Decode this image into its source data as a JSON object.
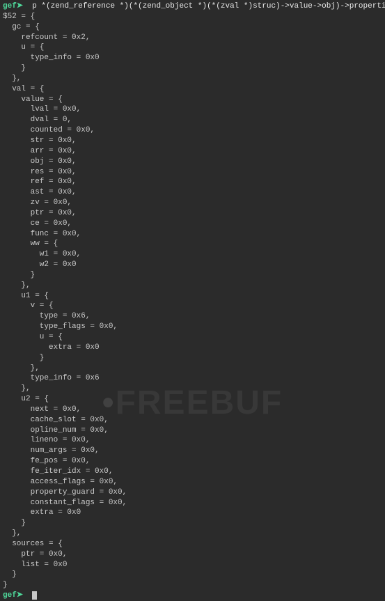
{
  "prompt_label": "gef➤",
  "command": "  p *(zend_reference *)(*(zend_object *)(*(zval *)struc)->value->obj)->properties_table->value->ref",
  "lines": [
    "$52 = {",
    "  gc = {",
    "    refcount = 0x2,",
    "    u = {",
    "      type_info = 0x0",
    "    }",
    "  },",
    "  val = {",
    "    value = {",
    "      lval = 0x0,",
    "      dval = 0,",
    "      counted = 0x0,",
    "      str = 0x0,",
    "      arr = 0x0,",
    "      obj = 0x0,",
    "      res = 0x0,",
    "      ref = 0x0,",
    "      ast = 0x0,",
    "      zv = 0x0,",
    "      ptr = 0x0,",
    "      ce = 0x0,",
    "      func = 0x0,",
    "      ww = {",
    "        w1 = 0x0,",
    "        w2 = 0x0",
    "      }",
    "    },",
    "    u1 = {",
    "      v = {",
    "        type = 0x6,",
    "        type_flags = 0x0,",
    "        u = {",
    "          extra = 0x0",
    "        }",
    "      },",
    "      type_info = 0x6",
    "    },",
    "    u2 = {",
    "      next = 0x0,",
    "      cache_slot = 0x0,",
    "      opline_num = 0x0,",
    "      lineno = 0x0,",
    "      num_args = 0x0,",
    "      fe_pos = 0x0,",
    "      fe_iter_idx = 0x0,",
    "      access_flags = 0x0,",
    "      property_guard = 0x0,",
    "      constant_flags = 0x0,",
    "      extra = 0x0",
    "    }",
    "  },",
    "  sources = {",
    "    ptr = 0x0,",
    "    list = 0x0",
    "  }",
    "}"
  ],
  "watermark": "FREEBUF"
}
